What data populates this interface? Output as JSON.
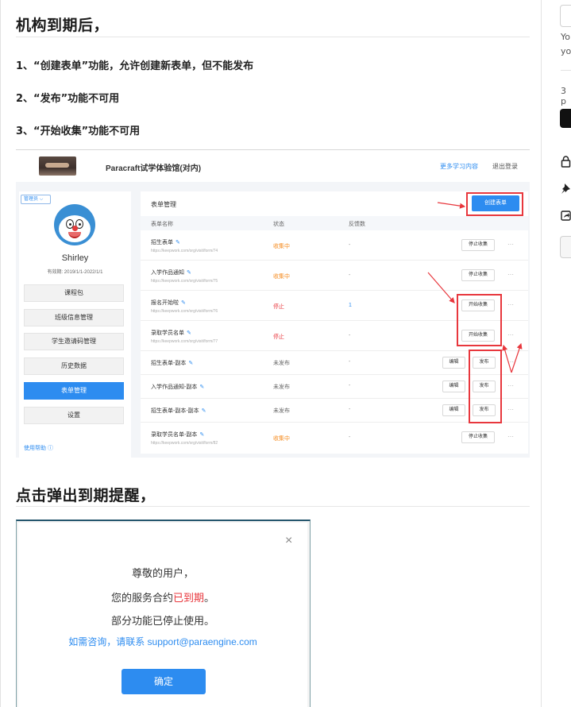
{
  "article": {
    "heading1": "机构到期后，",
    "items": [
      "1、“创建表单”功能，允许创建新表单，但不能发布",
      "2、“发布”功能不可用",
      "3、“开始收集”功能不可用"
    ],
    "heading2": "点击弹出到期提醒，"
  },
  "screenshot1": {
    "site_title": "Paracraft试学体验馆(对内)",
    "more_link": "更多学习内容",
    "logout": "退出登录",
    "role": "管理员",
    "user_name": "Shirley",
    "valid_period": "有效期: 2019/1/1-2022/1/1",
    "menu": [
      "课程包",
      "班级信息管理",
      "学生邀请码管理",
      "历史数据",
      "表单管理",
      "设置"
    ],
    "help": "使用帮助",
    "panel_title": "表单管理",
    "create_button": "创建表单",
    "columns": [
      "表单名称",
      "状态",
      "反馈数"
    ],
    "rows": [
      {
        "name": "招生表单",
        "url": "https://keepwork.com/org/visit/form/74",
        "status": "收集中",
        "count": "-",
        "action": "停止收集"
      },
      {
        "name": "入学作品通知",
        "url": "https://keepwork.com/org/visit/form/75",
        "status": "收集中",
        "count": "-",
        "action": "停止收集"
      },
      {
        "name": "报名开始啦",
        "url": "https://keepwork.com/org/visit/form/76",
        "status": "停止",
        "count": "1",
        "action": "开始收集"
      },
      {
        "name": "录取学员名单",
        "url": "https://keepwork.com/org/visit/form/77",
        "status": "停止",
        "count": "-",
        "action": "开始收集"
      },
      {
        "name": "招生表单-副本",
        "url": "",
        "status": "未发布",
        "count": "-",
        "edit": "编辑",
        "action": "发布"
      },
      {
        "name": "入学作品通知-副本",
        "url": "",
        "status": "未发布",
        "count": "-",
        "edit": "编辑",
        "action": "发布"
      },
      {
        "name": "招生表单-副本-副本",
        "url": "",
        "status": "未发布",
        "count": "-",
        "edit": "编辑",
        "action": "发布"
      },
      {
        "name": "录取学员名单-副本",
        "url": "https://keepwork.com/org/visit/form/82",
        "status": "收集中",
        "count": "-",
        "action": "停止收集"
      }
    ],
    "more": "···"
  },
  "dialog": {
    "close": "×",
    "line1": "尊敬的用户，",
    "line2_prefix": "您的服务合约",
    "line2_highlight": "已到期",
    "line2_suffix": "。",
    "line3": "部分功能已停止使用。",
    "contact": "如需咨询，请联系 support@paraengine.com",
    "ok": "确定"
  },
  "rail": {
    "text1": "Yo",
    "text2": "yo",
    "text3": "3 p"
  },
  "colors": {
    "accent": "#2d8cf0",
    "highlight": "#e8373d",
    "collecting": "#f58b1f",
    "stopped": "#e8373d",
    "unpublished": "#666666"
  },
  "icons": [
    "lock-icon",
    "pin-icon",
    "share-icon",
    "pencil-icon",
    "close-icon",
    "help-icon",
    "chevron-down-icon"
  ]
}
